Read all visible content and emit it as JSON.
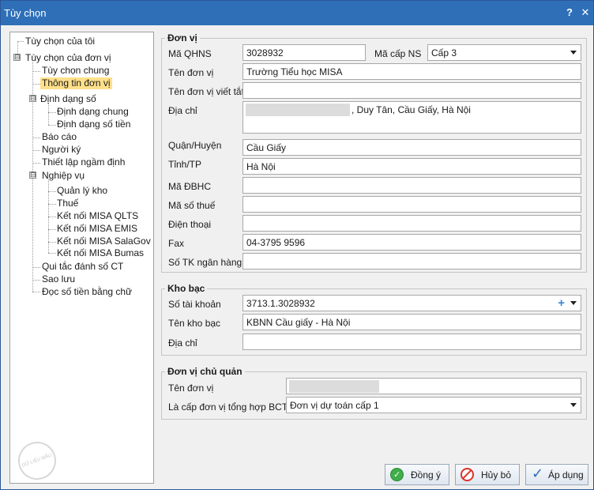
{
  "window": {
    "title": "Tùy chọn",
    "help_label": "?",
    "close_label": "✕"
  },
  "tree": {
    "items": [
      {
        "label": "Tùy chọn của tôi"
      },
      {
        "label": "Tùy chọn của đơn vị",
        "expander": "⊟"
      },
      {
        "label": "Tùy chọn chung"
      },
      {
        "label": "Thông tin đơn vị",
        "selected": true
      },
      {
        "label": "Định dạng số",
        "expander": "⊟"
      },
      {
        "label": "Định dạng chung"
      },
      {
        "label": "Định dạng số tiền"
      },
      {
        "label": "Báo cáo"
      },
      {
        "label": "Người ký"
      },
      {
        "label": "Thiết lập ngầm định"
      },
      {
        "label": "Nghiệp vụ",
        "expander": "⊟"
      },
      {
        "label": "Quản lý kho"
      },
      {
        "label": "Thuế"
      },
      {
        "label": "Kết nối MISA QLTS"
      },
      {
        "label": "Kết nối MISA EMIS"
      },
      {
        "label": "Kết nối MISA SalaGov"
      },
      {
        "label": "Kết nối MISA Bumas"
      },
      {
        "label": "Qui tắc đánh số CT"
      },
      {
        "label": "Sao lưu"
      },
      {
        "label": "Đọc số tiền bằng chữ"
      }
    ],
    "watermark_text": "DỮ LIỆU MẪU"
  },
  "don_vi": {
    "title": "Đơn vị",
    "ma_qhns": {
      "label": "Mã QHNS",
      "value": "3028932"
    },
    "ma_cap_ns": {
      "label": "Mã cấp NS",
      "value": "Cấp 3"
    },
    "ten_don_vi": {
      "label": "Tên đơn vị",
      "value": "Trường Tiểu học MISA"
    },
    "ten_viet_tat": {
      "label": "Tên đơn vị viết tắt",
      "value": ""
    },
    "dia_chi": {
      "label": "Địa chỉ",
      "value": ", Duy Tân, Cầu Giấy, Hà Nội"
    },
    "quan_huyen": {
      "label": "Quận/Huyện",
      "value": "Cầu Giấy"
    },
    "tinh_tp": {
      "label": "Tỉnh/TP",
      "value": "Hà Nội"
    },
    "ma_dbhc": {
      "label": "Mã ĐBHC",
      "value": ""
    },
    "ma_so_thue": {
      "label": "Mã số thuế",
      "value": ""
    },
    "dien_thoai": {
      "label": "Điện thoại",
      "value": ""
    },
    "fax": {
      "label": "Fax",
      "value": "04-3795 9596"
    },
    "so_tk_ngan_hang": {
      "label": "Số TK ngân hàng",
      "value": ""
    }
  },
  "kho_bac": {
    "title": "Kho bạc",
    "so_tai_khoan": {
      "label": "Số tài khoản",
      "value": "3713.1.3028932"
    },
    "ten_kho_bac": {
      "label": "Tên kho bạc",
      "value": "KBNN Cầu giấy - Hà Nội"
    },
    "dia_chi": {
      "label": "Địa chỉ",
      "value": ""
    }
  },
  "chu_quan": {
    "title": "Đơn vị chủ quản",
    "ten_don_vi": {
      "label": "Tên đơn vị",
      "value": ""
    },
    "cap_tong_hop": {
      "label": "Là cấp đơn vị tổng hợp BCTC",
      "value": "Đơn vị dự toán cấp 1"
    }
  },
  "buttons": {
    "ok": "Đồng ý",
    "cancel": "Hủy bỏ",
    "apply": "Áp dụng"
  },
  "icons": {
    "ok": "ok-check-icon",
    "cancel": "cancel-icon",
    "apply": "apply-check-icon",
    "add": "plus-icon"
  },
  "colors": {
    "titlebar": "#2e6fb8",
    "selection": "#ffe08a"
  }
}
